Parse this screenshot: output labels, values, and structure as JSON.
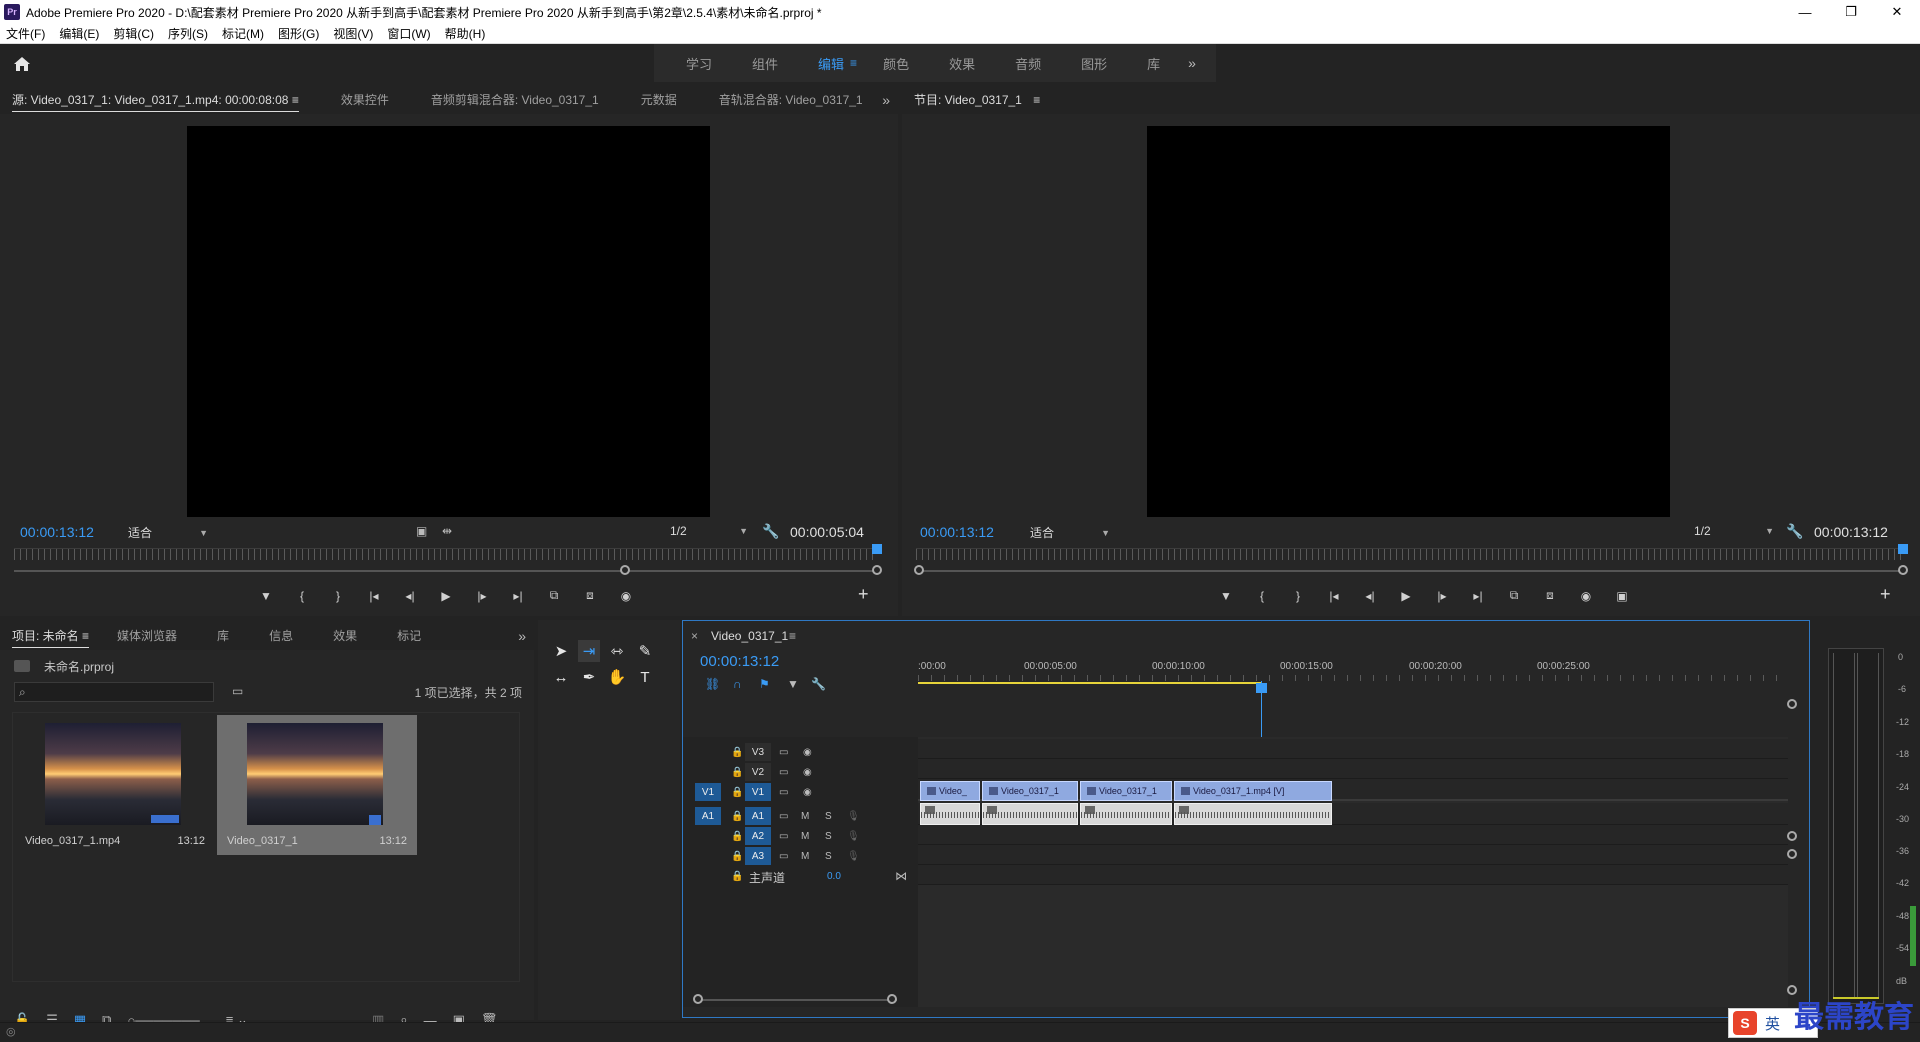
{
  "titlebar": {
    "app_icon": "Pr",
    "title": "Adobe Premiere Pro 2020 - D:\\配套素材 Premiere Pro 2020 从新手到高手\\配套素材 Premiere Pro 2020 从新手到高手\\第2章\\2.5.4\\素材\\未命名.prproj *",
    "minimize": "—",
    "restore": "❐",
    "close": "✕"
  },
  "menubar": {
    "items": [
      "文件(F)",
      "编辑(E)",
      "剪辑(C)",
      "序列(S)",
      "标记(M)",
      "图形(G)",
      "视图(V)",
      "窗口(W)",
      "帮助(H)"
    ]
  },
  "workspace": {
    "tabs": [
      "学习",
      "组件",
      "编辑",
      "颜色",
      "效果",
      "音频",
      "图形",
      "库"
    ],
    "active": "编辑",
    "more": "»"
  },
  "source_panel": {
    "tabs": [
      "源: Video_0317_1: Video_0317_1.mp4: 00:00:08:08",
      "效果控件",
      "音频剪辑混合器: Video_0317_1",
      "元数据",
      "音轨混合器: Video_0317_1"
    ],
    "menu_icon": "≡",
    "current_tc": "00:00:13:12",
    "fit": "适合",
    "resolution": "1/2",
    "duration_tc": "00:00:05:04"
  },
  "program_panel": {
    "tab": "节目: Video_0317_1",
    "menu_icon": "≡",
    "current_tc": "00:00:13:12",
    "fit": "适合",
    "resolution": "1/2",
    "duration_tc": "00:00:13:12"
  },
  "transport": {
    "source": [
      "▼",
      "{",
      "}",
      "|◂",
      "◂|",
      "▶",
      "|▸",
      "▸|",
      "⧉",
      "⧈",
      "◉"
    ],
    "program": [
      "▼",
      "{",
      "}",
      "|◂",
      "◂|",
      "▶",
      "|▸",
      "▸|",
      "⧉",
      "⧈",
      "◉",
      "▣"
    ],
    "add": "+"
  },
  "project_panel": {
    "tabs": [
      "项目: 未命名",
      "媒体浏览器",
      "库",
      "信息",
      "效果",
      "标记"
    ],
    "menu_icon": "≡",
    "project_file": "未命名.prproj",
    "selection_info": "1 项已选择，共 2 项",
    "items": [
      {
        "name": "Video_0317_1.mp4",
        "duration": "13:12"
      },
      {
        "name": "Video_0317_1",
        "duration": "13:12"
      }
    ]
  },
  "timeline": {
    "sequence_name": "Video_0317_1",
    "close": "×",
    "menu_icon": "≡",
    "current_tc": "00:00:13:12",
    "ruler_labels": [
      ":00:00",
      "00:00:05:00",
      "00:00:10:00",
      "00:00:15:00",
      "00:00:20:00",
      "00:00:25:00"
    ],
    "video_tracks": [
      "V3",
      "V2",
      "V1"
    ],
    "audio_tracks": [
      "A1",
      "A2",
      "A3"
    ],
    "source_v": "V1",
    "source_a": "A1",
    "master": "主声道",
    "master_value": "0.0",
    "m_label": "M",
    "s_label": "S",
    "video_clips": [
      "Video_",
      "Video_0317_1",
      "Video_0317_1",
      "Video_0317_1.mp4 [V]"
    ]
  },
  "meter": {
    "labels": [
      "0",
      "-6",
      "-12",
      "-18",
      "-24",
      "-30",
      "-36",
      "-42",
      "-48",
      "-54",
      "dB"
    ]
  },
  "watermark": {
    "text": "最需教育",
    "ime": "英"
  },
  "icons": {
    "home": "home-icon",
    "wrench": "wrench-icon",
    "search": "search-icon"
  },
  "colors": {
    "accent": "#3a9bf5",
    "video_clip": "#8fa9e0",
    "track_target": "#1e5a96"
  }
}
